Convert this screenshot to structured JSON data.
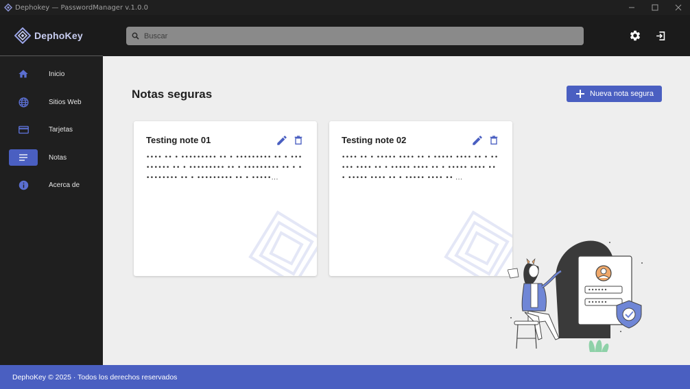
{
  "window": {
    "title": "Dephokey — PasswordManager v.1.0.0"
  },
  "header": {
    "brand": "DephoKey",
    "search_placeholder": "Buscar",
    "icons": [
      "settings-icon",
      "logout-icon"
    ]
  },
  "sidebar": {
    "items": [
      {
        "label": "Inicio",
        "icon": "home-icon",
        "active": false
      },
      {
        "label": "Sitios Web",
        "icon": "globe-icon",
        "active": false
      },
      {
        "label": "Tarjetas",
        "icon": "credit-card-icon",
        "active": false
      },
      {
        "label": "Notas",
        "icon": "notes-icon",
        "active": true
      },
      {
        "label": "Acerca de",
        "icon": "info-icon",
        "active": false
      }
    ]
  },
  "main": {
    "title": "Notas seguras",
    "new_button_label": "Nueva nota segura",
    "notes": [
      {
        "title": "Testing note 01",
        "preview": "•••• •• • ••••••••• •• • ••••••••• •• • ••••••••• •• • ••••••••• •• • ••••••••• •• • ••••••••• •• • ••••••••• •• • •••••..."
      },
      {
        "title": "Testing note 02",
        "preview": "•••• •• • ••••• •••• •• • ••••• •••• •• • ••••• •••• •• • ••••• •••• •• • ••••• •••• •• • ••••• •••• •• • ••••• •••• •• ..."
      }
    ]
  },
  "footer": {
    "text": "DephoKey © 2025 · Todos los derechos reservados"
  },
  "colors": {
    "accent": "#4a5fc1",
    "sidebar_bg": "#1f1f1f",
    "header_bg": "#1b1b1b",
    "main_bg": "#eeeeee"
  }
}
